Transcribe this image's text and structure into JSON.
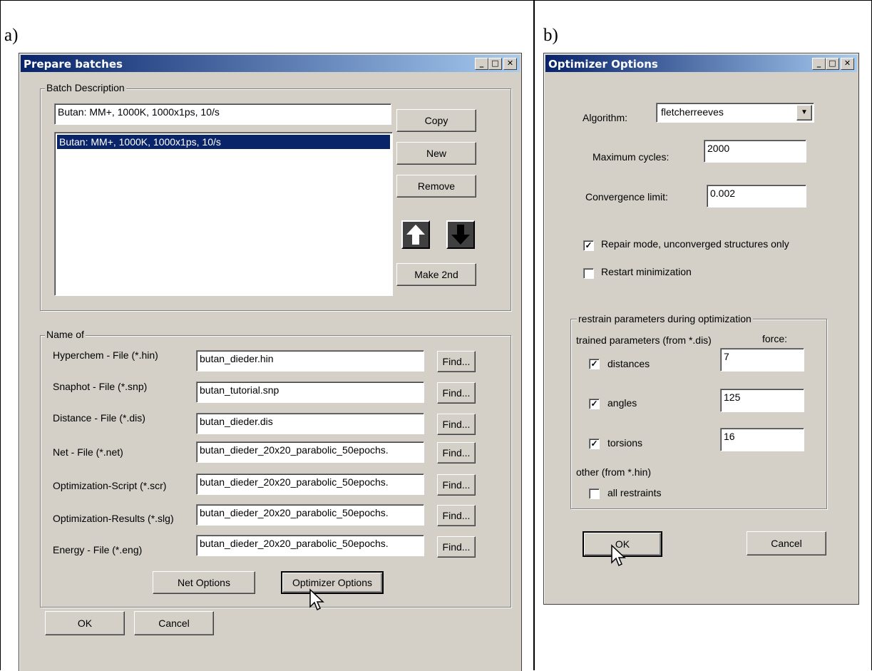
{
  "panels": {
    "a_label": "a)",
    "b_label": "b)"
  },
  "prepare": {
    "title": "Prepare batches",
    "batch_group_label": "Batch Description",
    "batch_name_value": "Butan: MM+, 1000K, 1000x1ps, 10/s",
    "batch_list": [
      "Butan: MM+, 1000K, 1000x1ps, 10/s"
    ],
    "copy_label": "Copy",
    "new_label": "New",
    "remove_label": "Remove",
    "make2nd_label": "Make 2nd",
    "nameof_group_label": "Name of",
    "files": [
      {
        "label": "Hyperchem - File (*.hin)",
        "value": "butan_dieder.hin",
        "find": "Find..."
      },
      {
        "label": "Snaphot - File (*.snp)",
        "value": "butan_tutorial.snp",
        "find": "Find..."
      },
      {
        "label": "Distance - File (*.dis)",
        "value": "butan_dieder.dis",
        "find": "Find..."
      },
      {
        "label": "Net - File (*.net)",
        "value": "butan_dieder_20x20_parabolic_50epochs.",
        "find": "Find..."
      },
      {
        "label": "Optimization-Script (*.scr)",
        "value": "butan_dieder_20x20_parabolic_50epochs.",
        "find": "Find..."
      },
      {
        "label": "Optimization-Results (*.slg)",
        "value": "butan_dieder_20x20_parabolic_50epochs.",
        "find": "Find..."
      },
      {
        "label": "Energy - File (*.eng)",
        "value": "butan_dieder_20x20_parabolic_50epochs.",
        "find": "Find..."
      }
    ],
    "net_options_label": "Net Options",
    "optimizer_options_label": "Optimizer Options",
    "ok_label": "OK",
    "cancel_label": "Cancel"
  },
  "optimizer": {
    "title": "Optimizer Options",
    "algorithm_label": "Algorithm:",
    "algorithm_value": "fletcherreeves",
    "max_cycles_label": "Maximum cycles:",
    "max_cycles_value": "2000",
    "convergence_label": "Convergence limit:",
    "convergence_value": "0.002",
    "repair_label": "Repair mode, unconverged structures only",
    "repair_checked": true,
    "restart_label": "Restart minimization",
    "restart_checked": false,
    "restrain_group_label": "restrain parameters during optimization",
    "trained_label": "trained parameters (from *.dis)",
    "force_label": "force:",
    "distances_label": "distances",
    "distances_value": "7",
    "angles_label": "angles",
    "angles_value": "125",
    "torsions_label": "torsions",
    "torsions_value": "16",
    "other_label": "other (from *.hin)",
    "all_restraints_label": "all restraints",
    "ok_label": "OK",
    "cancel_label": "Cancel"
  },
  "icons": {
    "minimize": "_",
    "maximize": "□",
    "close": "✕",
    "check": "✓",
    "dropdown": "▼"
  }
}
